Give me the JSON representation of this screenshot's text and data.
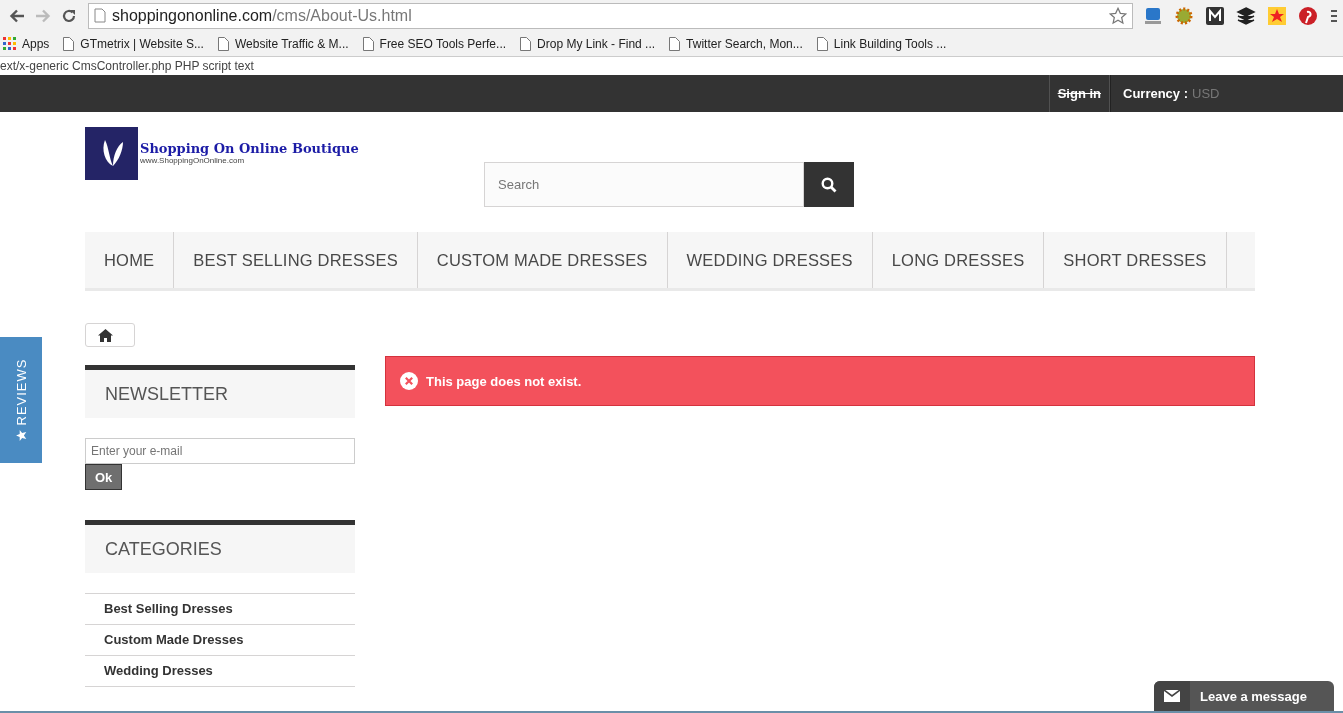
{
  "browser": {
    "url_host": "shoppingononline.com",
    "url_path": "/cms/About-Us.html",
    "bookmarks": [
      {
        "label": "Apps",
        "kind": "apps"
      },
      {
        "label": "GTmetrix | Website S...",
        "kind": "page"
      },
      {
        "label": "Website Traffic & M...",
        "kind": "page"
      },
      {
        "label": "Free SEO Tools Perfe...",
        "kind": "page"
      },
      {
        "label": "Drop My Link - Find ...",
        "kind": "page"
      },
      {
        "label": "Twitter Search, Mon...",
        "kind": "page"
      },
      {
        "label": "Link Building Tools ...",
        "kind": "page"
      }
    ],
    "status_text": "ext/x-generic CmsController.php PHP script text"
  },
  "top_bar": {
    "sign_in": "Sign in",
    "currency_label": "Currency :",
    "currency_value": "USD"
  },
  "logo": {
    "title": "Shopping On Online Boutique",
    "tagline": "www.ShoppingOnOnline.com"
  },
  "search": {
    "placeholder": "Search"
  },
  "nav": [
    {
      "label": "HOME"
    },
    {
      "label": "BEST SELLING DRESSES"
    },
    {
      "label": "CUSTOM MADE DRESSES"
    },
    {
      "label": "WEDDING DRESSES"
    },
    {
      "label": "LONG DRESSES"
    },
    {
      "label": "SHORT DRESSES"
    }
  ],
  "reviews_tab": {
    "label": "REVIEWS"
  },
  "newsletter": {
    "title": "NEWSLETTER",
    "placeholder": "Enter your e-mail",
    "button": "Ok"
  },
  "categories": {
    "title": "CATEGORIES",
    "items": [
      {
        "label": "Best Selling Dresses"
      },
      {
        "label": "Custom Made Dresses"
      },
      {
        "label": "Wedding Dresses"
      }
    ]
  },
  "alert": {
    "message": "This page does not exist."
  },
  "chat": {
    "label": "Leave a message"
  }
}
